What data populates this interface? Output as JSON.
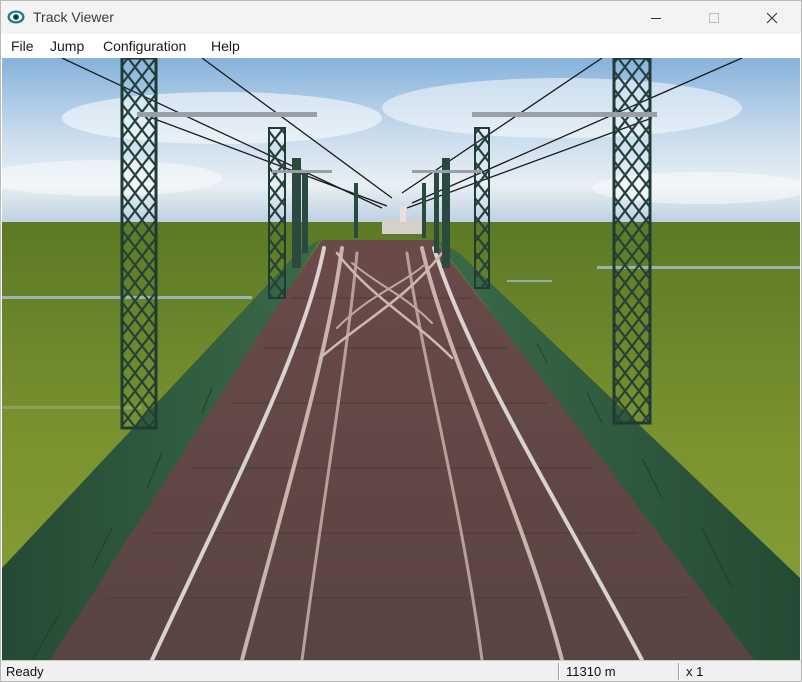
{
  "window": {
    "title": "Track Viewer",
    "icon": "eye-icon"
  },
  "menu": {
    "items": [
      "File",
      "Jump",
      "Configuration",
      "Help"
    ]
  },
  "viewport": {
    "description_colors": {
      "sky_top": "#8fb7dc",
      "grass": "#6f8a2c",
      "track_bed": "#5b4644",
      "rail": "#b49a92",
      "railing": "#2f5a3a",
      "pylon": "#1f3b33"
    }
  },
  "status": {
    "ready": "Ready",
    "distance": "11310 m",
    "speed": "x 1"
  }
}
